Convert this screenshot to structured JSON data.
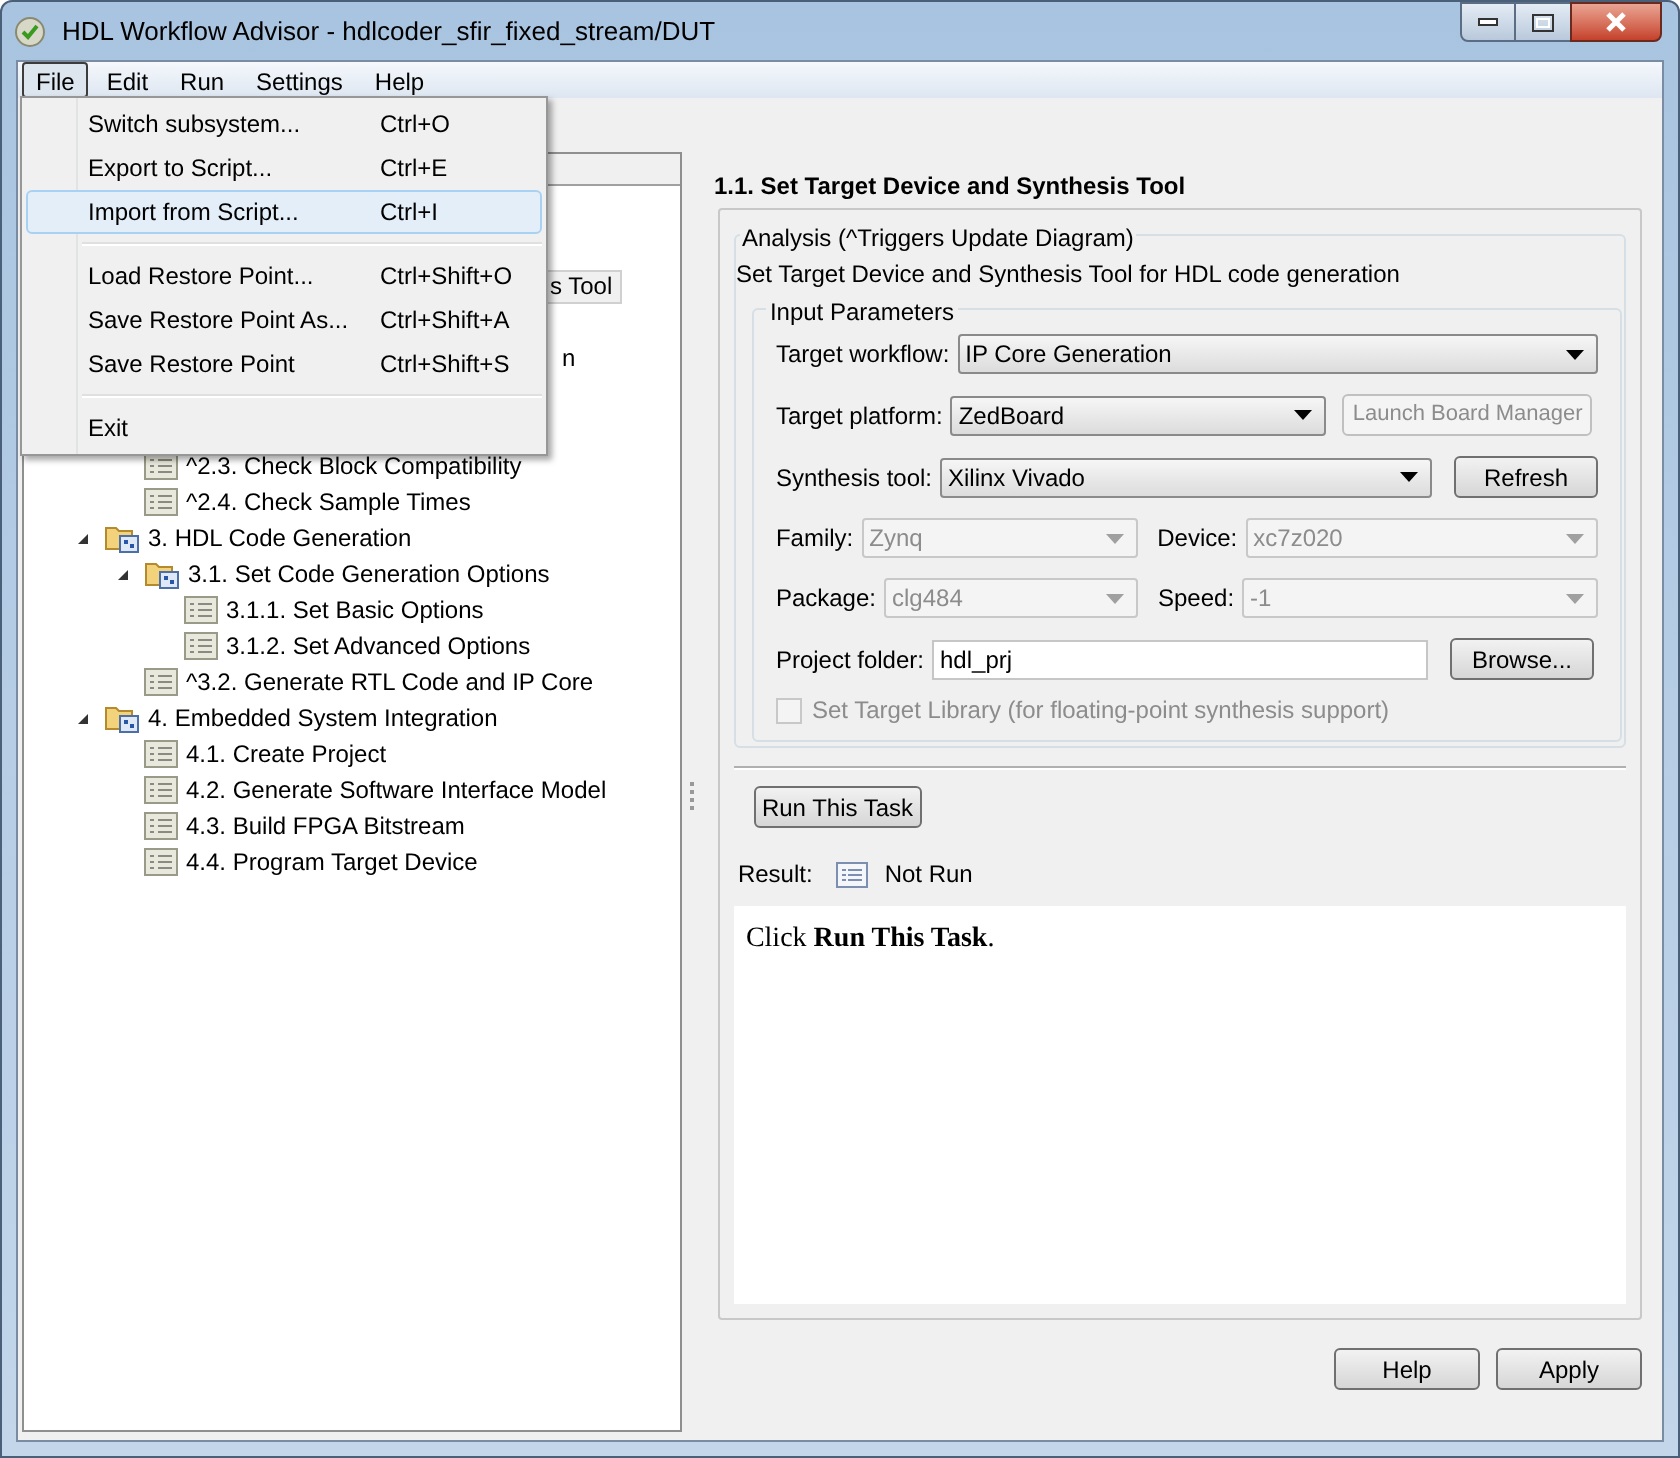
{
  "window": {
    "title": "HDL Workflow Advisor - hdlcoder_sfir_fixed_stream/DUT"
  },
  "menu_bar": [
    {
      "label": "File",
      "selected": true
    },
    {
      "label": "Edit",
      "selected": false
    },
    {
      "label": "Run",
      "selected": false
    },
    {
      "label": "Settings",
      "selected": false
    },
    {
      "label": "Help",
      "selected": false
    }
  ],
  "file_menu": [
    {
      "kind": "item",
      "label": "Switch subsystem...",
      "shortcut": "Ctrl+O",
      "selected": false
    },
    {
      "kind": "item",
      "label": "Export to Script...",
      "shortcut": "Ctrl+E",
      "selected": false
    },
    {
      "kind": "item",
      "label": "Import from Script...",
      "shortcut": "Ctrl+I",
      "selected": true
    },
    {
      "kind": "separator"
    },
    {
      "kind": "item",
      "label": "Load Restore Point...",
      "shortcut": "Ctrl+Shift+O",
      "selected": false
    },
    {
      "kind": "item",
      "label": "Save Restore Point As...",
      "shortcut": "Ctrl+Shift+A",
      "selected": false
    },
    {
      "kind": "item",
      "label": "Save Restore Point",
      "shortcut": "Ctrl+Shift+S",
      "selected": false
    },
    {
      "kind": "separator"
    },
    {
      "kind": "item",
      "label": "Exit",
      "selected": false
    }
  ],
  "tree_partial": [
    {
      "label": "s Tool",
      "selected": true
    },
    {
      "label": "n",
      "selected": false
    }
  ],
  "tree": [
    {
      "children": [
        {
          "kind": "task",
          "label": "^2.3. Check Block Compatibility"
        },
        {
          "kind": "task",
          "label": "^2.4. Check Sample Times"
        }
      ]
    },
    {
      "kind": "folder",
      "label": "3. HDL Code Generation",
      "expanded": true,
      "children": [
        {
          "kind": "folder",
          "label": "3.1. Set Code Generation Options",
          "expanded": true,
          "children": [
            {
              "kind": "task",
              "label": "3.1.1. Set Basic Options"
            },
            {
              "kind": "task",
              "label": "3.1.2. Set Advanced Options"
            }
          ]
        },
        {
          "kind": "task",
          "label": "^3.2. Generate RTL Code and IP Core"
        }
      ]
    },
    {
      "kind": "folder",
      "label": "4. Embedded System Integration",
      "expanded": true,
      "children": [
        {
          "kind": "task",
          "label": "4.1. Create Project"
        },
        {
          "kind": "task",
          "label": "4.2. Generate Software Interface Model"
        },
        {
          "kind": "task",
          "label": "4.3. Build FPGA Bitstream"
        },
        {
          "kind": "task",
          "label": "4.4. Program Target Device"
        }
      ]
    }
  ],
  "task": {
    "title": "1.1. Set Target Device and Synthesis Tool",
    "analysis_legend": "Analysis (^Triggers Update Diagram)",
    "description": "Set Target Device and Synthesis Tool for HDL code generation",
    "input_legend": "Input Parameters",
    "target_workflow": {
      "label": "Target workflow:",
      "value": "IP Core Generation",
      "disabled": false
    },
    "target_platform": {
      "label": "Target platform:",
      "value": "ZedBoard",
      "disabled": false
    },
    "launch_board_manager": {
      "label": "Launch Board Manager",
      "disabled": true
    },
    "synthesis_tool": {
      "label": "Synthesis tool:",
      "value": "Xilinx Vivado",
      "disabled": false
    },
    "refresh": {
      "label": "Refresh",
      "disabled": false
    },
    "family": {
      "label": "Family:",
      "value": "Zynq",
      "disabled": true
    },
    "device": {
      "label": "Device:",
      "value": "xc7z020",
      "disabled": true
    },
    "package": {
      "label": "Package:",
      "value": "clg484",
      "disabled": true
    },
    "speed": {
      "label": "Speed:",
      "value": "-1",
      "disabled": true
    },
    "project_folder": {
      "label": "Project folder:",
      "value": "hdl_prj"
    },
    "browse": {
      "label": "Browse...",
      "disabled": false
    },
    "target_library": {
      "label": "Set Target Library (for floating-point synthesis support)",
      "checked": false,
      "disabled": true
    },
    "run_button": "Run This Task",
    "result_label": "Result:",
    "result_value": "Not Run",
    "result_text": "Click **Run This Task**."
  },
  "buttons": [
    "Help",
    "Apply"
  ]
}
